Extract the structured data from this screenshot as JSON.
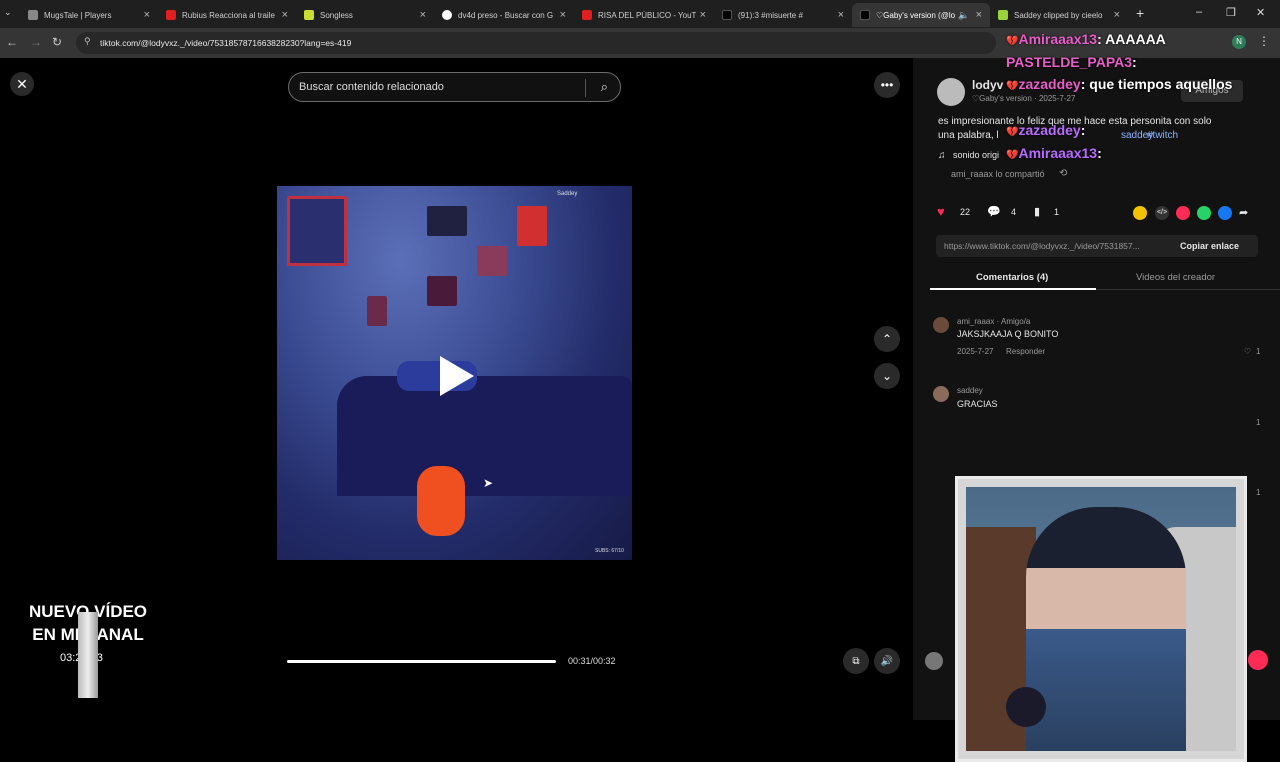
{
  "browser": {
    "tabs": [
      {
        "title": "MugsTale | Players",
        "fav": "#888888"
      },
      {
        "title": "Rubius Reacciona al traile",
        "fav": "#e02020"
      },
      {
        "title": "Songless",
        "fav": "#ccdd33"
      },
      {
        "title": "dv4d preso - Buscar con G",
        "fav": "#ffffff"
      },
      {
        "title": "RISA DEL PÚBLICO - YouT",
        "fav": "#e02020"
      },
      {
        "title": "(91):3 #misuerte #",
        "fav": "#000000"
      },
      {
        "title": "♡Gaby's version (@lo",
        "fav": "#000000"
      },
      {
        "title": "Saddey clipped by cieelo",
        "fav": "#9bd33a"
      }
    ],
    "new_tab": "+",
    "window": {
      "minimize": "–",
      "restore": "❐",
      "close": "✕"
    },
    "url": "tiktok.com/@lodyvxz._/video/7531857871663828230?lang=es-419",
    "profile_initial": "N"
  },
  "player": {
    "search_placeholder": "Buscar contenido relacionado",
    "time": "00:31/00:32",
    "video_watermark": "Saddey",
    "video_subs": "SUBS: 67/10"
  },
  "panel": {
    "username": "lodyv",
    "display": "♡Gaby's version · 2025-7-27",
    "follow": "Amigos",
    "description_1": "es impresionante lo feliz que me hace esta personita con solo",
    "description_2": "una palabra, l",
    "hashtag_1": "saddey",
    "hashtag_2": "#twitch",
    "sound": "sonido origi",
    "shared_by": "ami_raaax lo compartió",
    "likes": "22",
    "comments": "4",
    "saves": "1",
    "link": "https://www.tiktok.com/@lodyvxz._/video/7531857...",
    "copy": "Copiar enlace",
    "tab_comments": "Comentarios (4)",
    "tab_creator": "Videos del creador",
    "comment_list": [
      {
        "user": "ami_raaax · Amigo/a",
        "text": "JAKSJKAAJA Q BONITO",
        "date": "2025-7-27",
        "reply": "Responder",
        "likes": "1"
      },
      {
        "user": "saddey",
        "text": "GRACIAS"
      }
    ],
    "side_counts": [
      "1",
      "1"
    ]
  },
  "stream_chat": [
    {
      "user": "Amiraaax13",
      "msg": "AAAAAA",
      "color": "#e85ec8"
    },
    {
      "user": "PASTELDE_PAPA3",
      "msg": "",
      "color": "#e85ec8"
    },
    {
      "user": "zazaddey",
      "msg": "que tiempos aquellos",
      "color": "#e85ec8"
    },
    {
      "user": "zazaddey",
      "msg": "",
      "color": "#b86cff"
    },
    {
      "user": "Amiraaax13",
      "msg": "",
      "color": "#b86cff"
    }
  ],
  "overlay": {
    "line1": "NUEVO VÍDEO",
    "line2": "EN MI CANAL",
    "timer": "03:23:33"
  }
}
